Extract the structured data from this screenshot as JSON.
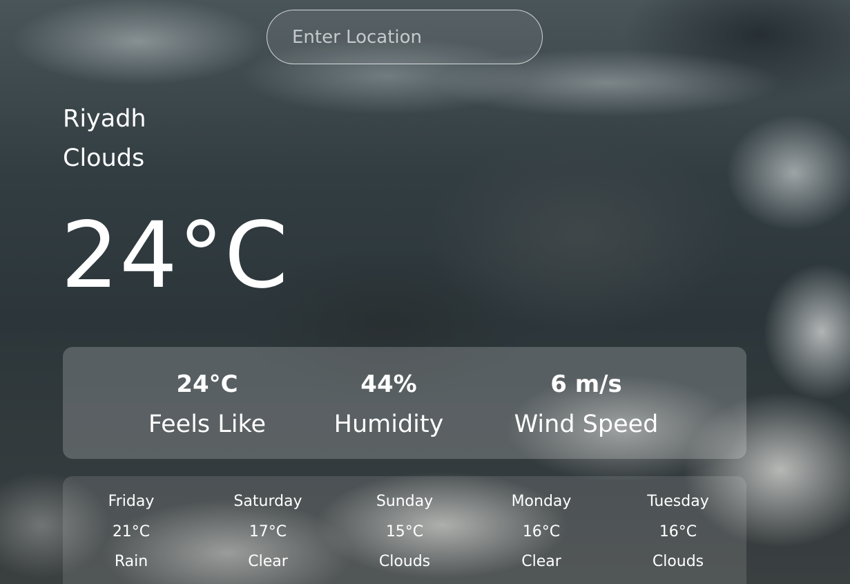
{
  "search": {
    "placeholder": "Enter Location",
    "value": ""
  },
  "current": {
    "location": "Riyadh",
    "condition": "Clouds",
    "temperature": "24°C"
  },
  "stats": {
    "feels_like": {
      "value": "24°C",
      "label": "Feels Like"
    },
    "humidity": {
      "value": "44%",
      "label": "Humidity"
    },
    "wind_speed": {
      "value": "6 m/s",
      "label": "Wind Speed"
    }
  },
  "forecast": [
    {
      "day": "Friday",
      "temp": "21°C",
      "condition": "Rain"
    },
    {
      "day": "Saturday",
      "temp": "17°C",
      "condition": "Clear"
    },
    {
      "day": "Sunday",
      "temp": "15°C",
      "condition": "Clouds"
    },
    {
      "day": "Monday",
      "temp": "16°C",
      "condition": "Clear"
    },
    {
      "day": "Tuesday",
      "temp": "16°C",
      "condition": "Clouds"
    }
  ]
}
